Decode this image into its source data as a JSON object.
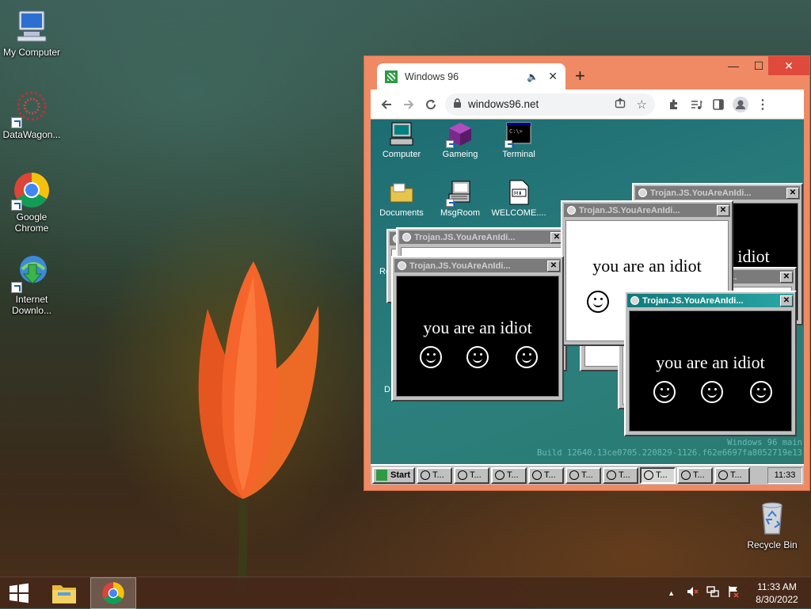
{
  "desktop": {
    "icons": [
      {
        "label": "My Computer"
      },
      {
        "label": "DataWagon..."
      },
      {
        "label": "Google Chrome"
      },
      {
        "label": "Internet Downlo..."
      },
      {
        "label": "Recycle Bin"
      }
    ]
  },
  "browser": {
    "tab_title": "Windows 96",
    "new_tab": "+",
    "url": "windows96.net",
    "controls": {
      "minimize": "—",
      "maximize": "☐",
      "close": "✕"
    },
    "toolbar_icons": [
      "back-icon",
      "forward-icon",
      "reload-icon",
      "share-icon",
      "star-icon",
      "extensions-icon",
      "media-icon",
      "sidepanel-icon",
      "profile-icon",
      "menu-icon"
    ]
  },
  "w96": {
    "icons": [
      {
        "label": "Computer"
      },
      {
        "label": "Gameing"
      },
      {
        "label": "Terminal"
      },
      {
        "label": "Documents"
      },
      {
        "label": "MsgRoom"
      },
      {
        "label": "WELCOME...."
      }
    ],
    "partial_icon_labels": [
      "Re",
      "D"
    ],
    "dialog_title": "Trojan.JS.YouAreAnIdi...",
    "message": "you are an idiot",
    "build_line1": "Windows 96 main",
    "build_line2": "Build 12640.13ce0705.220829-1126.f62e6697fa8052719e13",
    "taskbar": {
      "start": "Start",
      "task_label": "T...",
      "task_count": 9,
      "clock": "11:33"
    }
  },
  "taskbar": {
    "time": "11:33 AM",
    "date": "8/30/2022",
    "tray_chevron": "▲"
  },
  "colors": {
    "chrome_frame": "#f08a64",
    "w96_desktop": "#1f6f72",
    "w96_active_title": "#0f7a7a"
  }
}
